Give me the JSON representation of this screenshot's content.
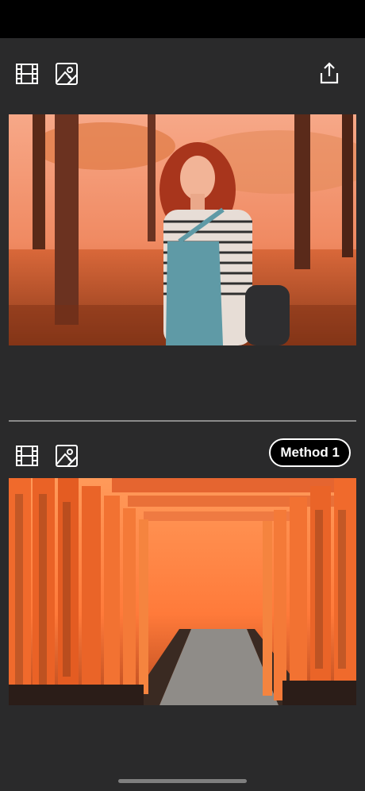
{
  "top_toolbar": {
    "film_icon": "film-icon",
    "image_icon": "image-icon",
    "share_icon": "share-icon"
  },
  "top_photo": {
    "subject": "woman-in-autumn-park"
  },
  "bottom_toolbar": {
    "film_icon": "film-icon",
    "image_icon": "image-icon",
    "method_label": "Method 1"
  },
  "bottom_photo": {
    "subject": "torii-gate-path"
  },
  "colors": {
    "background": "#2a2a2b",
    "status_bar": "#000000",
    "divider": "#8a8a8a",
    "accent": "#ff6a3a"
  }
}
